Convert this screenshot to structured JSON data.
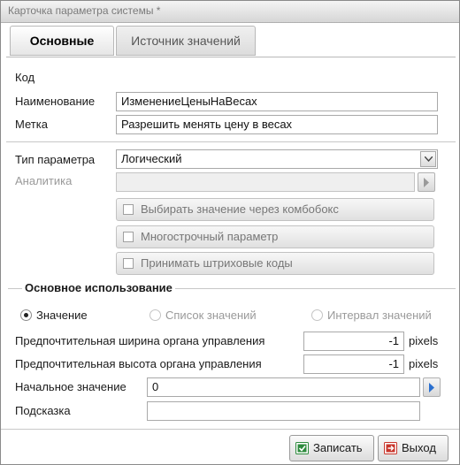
{
  "window": {
    "title": "Карточка параметра системы *"
  },
  "tabs": [
    {
      "label": "Основные",
      "active": true
    },
    {
      "label": "Источник значений",
      "active": false
    }
  ],
  "form": {
    "code_label": "Код",
    "name_label": "Наименование",
    "name_value": "ИзменениеЦеныНаВесах",
    "caption_label": "Метка",
    "caption_value": "Разрешить менять цену в весах",
    "type_label": "Тип параметра",
    "type_value": "Логический",
    "analytics_label": "Аналитика",
    "analytics_value": "",
    "check_combobox": "Выбирать значение через комбобокс",
    "check_multiline": "Многострочный параметр",
    "check_barcodes": "Принимать штриховые коды"
  },
  "usage": {
    "title": "Основное использование",
    "radio_value": "Значение",
    "radio_list": "Список значений",
    "radio_interval": "Интервал значений",
    "selected": "Значение",
    "width_label": "Предпочтительная ширина органа управления",
    "width_value": "-1",
    "height_label": "Предпочтительная высота органа управления",
    "height_value": "-1",
    "unit": "pixels",
    "initial_label": "Начальное значение",
    "initial_value": "0",
    "hint_label": "Подсказка",
    "hint_value": ""
  },
  "buttons": {
    "save": "Записать",
    "exit": "Выход"
  },
  "icons": {
    "save": "save-icon",
    "exit": "exit-icon",
    "combo": "chevron-down-icon",
    "select": "arrow-right-icon"
  },
  "colors": {
    "accent_blue": "#2a6fcf",
    "save_green": "#2e8b3e",
    "exit_red": "#c8352b"
  }
}
